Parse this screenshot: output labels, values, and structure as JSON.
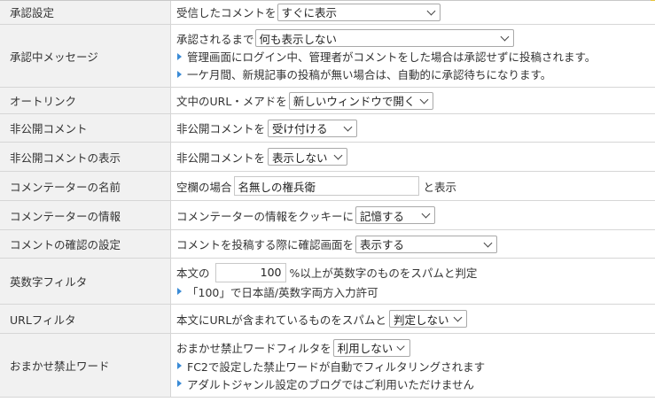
{
  "rows": [
    {
      "label": "承認設定",
      "prefix": "受信したコメントを",
      "select": "すぐに表示"
    },
    {
      "label": "承認中メッセージ",
      "prefix": "承認されるまで",
      "select": "何も表示しない",
      "notes": [
        "管理画面にログイン中、管理者がコメントをした場合は承認せずに投稿されます。",
        "一ケ月間、新規記事の投稿が無い場合は、自動的に承認待ちになります。"
      ]
    },
    {
      "label": "オートリンク",
      "prefix": "文中のURL・メアドを",
      "select": "新しいウィンドウで開く"
    },
    {
      "label": "非公開コメント",
      "prefix": "非公開コメントを",
      "select": "受け付ける"
    },
    {
      "label": "非公開コメントの表示",
      "prefix": "非公開コメントを",
      "select": "表示しない"
    },
    {
      "label": "コメンテーターの名前",
      "prefix": "空欄の場合",
      "input": "名無しの権兵衛",
      "suffix": "と表示"
    },
    {
      "label": "コメンテーターの情報",
      "prefix": "コメンテーターの情報をクッキーに",
      "select": "記憶する"
    },
    {
      "label": "コメントの確認の設定",
      "prefix": "コメントを投稿する際に確認画面を",
      "select": "表示する"
    },
    {
      "label": "英数字フィルタ",
      "prefix": "本文の",
      "input": "100",
      "suffix": "%以上が英数字のものをスパムと判定",
      "notes": [
        "「100」で日本語/英数字両方入力許可"
      ]
    },
    {
      "label": "URLフィルタ",
      "prefix": "本文にURLが含まれているものをスパムと",
      "select": "判定しない"
    },
    {
      "label": "おまかせ禁止ワード",
      "prefix": "おまかせ禁止ワードフィルタを",
      "select": "利用しない",
      "notes": [
        "FC2で設定した禁止ワードが自動でフィルタリングされます",
        "アダルトジャンル設定のブログではご利用いただけません"
      ]
    }
  ]
}
